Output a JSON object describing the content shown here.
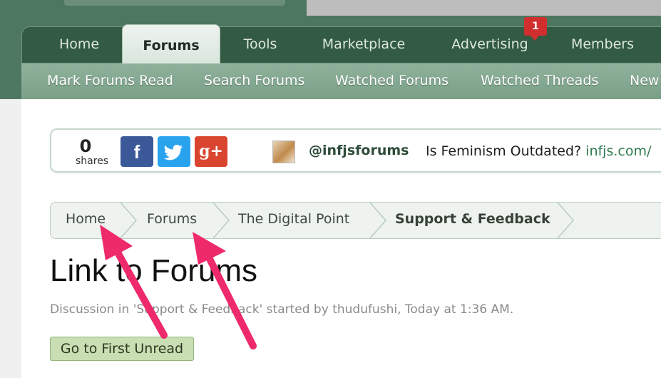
{
  "nav": {
    "tabs": [
      {
        "label": "Home"
      },
      {
        "label": "Forums"
      },
      {
        "label": "Tools"
      },
      {
        "label": "Marketplace"
      },
      {
        "label": "Advertising"
      },
      {
        "label": "Members"
      }
    ],
    "active_tab": "Forums",
    "advertising_badge": "1"
  },
  "subnav": {
    "links": [
      {
        "label": "Mark Forums Read"
      },
      {
        "label": "Search Forums"
      },
      {
        "label": "Watched Forums"
      },
      {
        "label": "Watched Threads"
      },
      {
        "label": "New"
      }
    ]
  },
  "share_bar": {
    "count": "0",
    "count_label": "shares",
    "buttons": {
      "facebook": "f",
      "twitter": "twitter-bird-icon",
      "googleplus": "g+"
    },
    "handle": "@infjsforums",
    "tweet_text": "Is Feminism Outdated?",
    "tweet_link": "infjs.com/"
  },
  "breadcrumb": {
    "items": [
      {
        "label": "Home"
      },
      {
        "label": "Forums"
      },
      {
        "label": "The Digital Point"
      },
      {
        "label": "Support & Feedback"
      }
    ]
  },
  "thread": {
    "title": "Link to Forums",
    "description": "Discussion in 'Support & Feedback' started by thudufushi, Today at 1:36 AM.",
    "first_unread_label": "Go to First Unread"
  },
  "colors": {
    "header_bg": "#4e7760",
    "nav_bg": "#335a43",
    "subnav_bg": "#7aa088",
    "badge": "#d12f2f",
    "arrow_annotation": "#ee2a6b",
    "facebook": "#3b5998",
    "twitter": "#2aa3ef",
    "googleplus": "#d9452f"
  }
}
